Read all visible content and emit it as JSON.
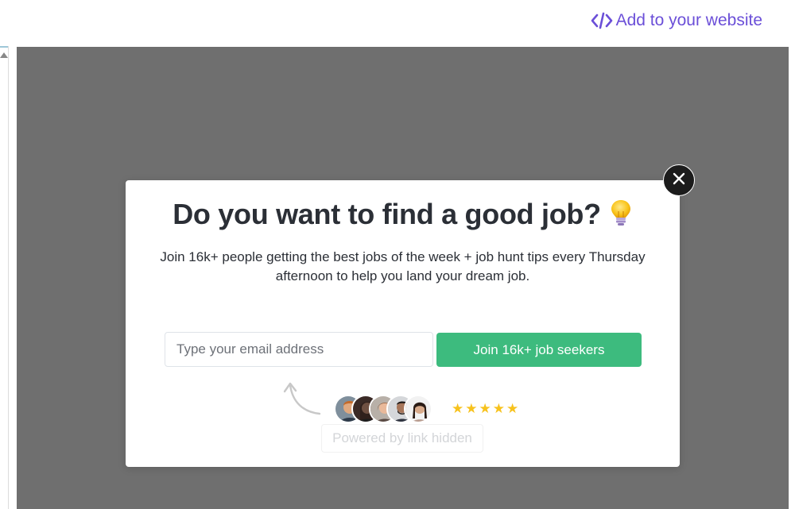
{
  "topbar": {
    "embed_label": "Add to your website",
    "embed_icon": "code-brackets-icon",
    "accent_color": "#6b4fd8"
  },
  "popup": {
    "title": "Do you want to find a good job?",
    "title_icon": "lightbulb-icon",
    "subtitle": "Join 16k+ people getting the best jobs of the week + job hunt tips every Thursday afternoon to help you land your dream job.",
    "email_placeholder": "Type your email address",
    "email_value": "",
    "cta_label": "Join 16k+ job seekers",
    "cta_color": "#3dbb7e",
    "rating_stars": 5,
    "star_color": "#f7c21d",
    "powered_by": "Powered by link hidden",
    "close_icon": "close-icon"
  },
  "colors": {
    "overlay": "#6f6f6f",
    "modal_bg": "#ffffff",
    "close_bg": "#1c1c1c"
  }
}
